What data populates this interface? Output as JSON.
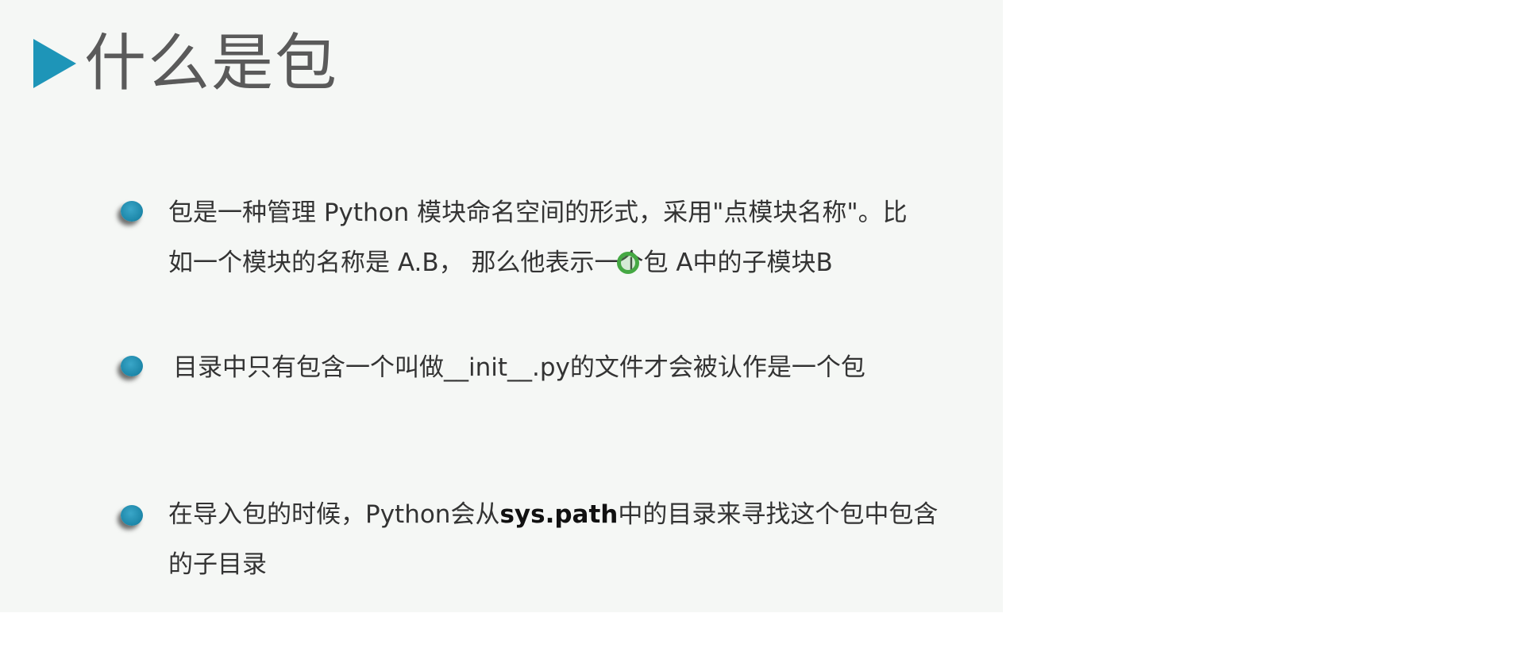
{
  "slide": {
    "title": "什么是包",
    "items": [
      {
        "lines": [
          "包是一种管理 Python 模块命名空间的形式，采用\"点模块名称\"。比",
          "如一个模块的名称是 A.B， 那么他表示一个包 A中的子模块B"
        ]
      },
      {
        "lines": [
          "目录中只有包含一个叫做__init__.py的文件才会被认作是一个包"
        ]
      },
      {
        "line1_before": "在导入包的时候，Python会从",
        "line1_bold": "sys.path",
        "line1_after": "中的目录来寻找这个包中包含",
        "line2": "的子目录"
      }
    ]
  },
  "colors": {
    "accent": "#1e95b8",
    "slide_bg": "#f5f7f5",
    "text": "#333333",
    "cursor": "#45a843"
  },
  "icons": {
    "title_marker": "play-triangle-icon",
    "bullet": "bullet-dot-icon",
    "cursor": "mouse-cursor-highlight-icon"
  }
}
